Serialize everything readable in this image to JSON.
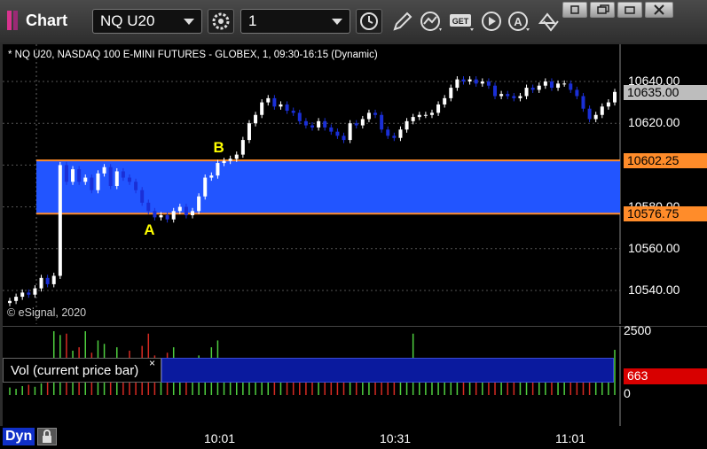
{
  "window": {
    "app_title": "Chart",
    "symbol": "NQ U20",
    "interval": "1"
  },
  "chart_header": "* NQ U20, NASDAQ 100 E-MINI FUTURES - GLOBEX, 1, 09:30-16:15 (Dynamic)",
  "copyright": "© eSignal, 2020",
  "colors": {
    "up": "#ffffff",
    "down": "#1a2fd6",
    "zone_fill": "#2255ff",
    "zone_line": "#ff8c2a",
    "last_price_tag": "#bdbdbd",
    "vol_up": "#4fcf3f",
    "vol_down": "#d62a22",
    "vol_tag": "#d80000",
    "annotation": "#ffff00"
  },
  "bottom": {
    "dyn_label": "Dyn",
    "time_labels": [
      "10:01",
      "10:31",
      "11:01"
    ]
  },
  "volume_pane": {
    "title": "Vol (current price bar)",
    "close_glyph": "×",
    "axis_labels": [
      "2500",
      "0"
    ],
    "current_value": "663"
  },
  "chart_data": {
    "type": "candlestick",
    "y_axis_ticks": [
      10640,
      10620,
      10600,
      10580,
      10560,
      10540
    ],
    "y_axis_labels": [
      "10640.00",
      "10620.00",
      "10600.00",
      "10580.00",
      "10560.00",
      "10540.00"
    ],
    "y_range": [
      10532,
      10650
    ],
    "x_time_ticks": [
      "10:01",
      "10:31",
      "11:01"
    ],
    "last_price": "10635.00",
    "zone": {
      "upper": 10602.25,
      "lower": 10576.75,
      "upper_label": "10602.25",
      "lower_label": "10576.75"
    },
    "annotations": [
      {
        "text": "A",
        "bar": 22,
        "price": 10573
      },
      {
        "text": "B",
        "bar": 33,
        "price": 10605
      }
    ],
    "closes": [
      10535,
      10537,
      10539,
      10538,
      10541,
      10546,
      10543,
      10547,
      10600,
      10592,
      10598,
      10592,
      10594,
      10588,
      10596,
      10599,
      10590,
      10597,
      10594,
      10592,
      10588,
      10582,
      10578,
      10575,
      10576,
      10574,
      10578,
      10580,
      10576,
      10578,
      10585,
      10594,
      10595,
      10601,
      10602,
      10603,
      10605,
      10612,
      10620,
      10624,
      10630,
      10632,
      10628,
      10629,
      10626,
      10625,
      10621,
      10619,
      10618,
      10621,
      10618,
      10616,
      10614,
      10612,
      10620,
      10619,
      10622,
      10625,
      10624,
      10617,
      10614,
      10613,
      10617,
      10621,
      10623,
      10624,
      10624,
      10625,
      10629,
      10632,
      10637,
      10641,
      10640,
      10641,
      10639,
      10640,
      10638,
      10633,
      10634,
      10633,
      10632,
      10633,
      10637,
      10636,
      10638,
      10640,
      10637,
      10639,
      10639,
      10636,
      10633,
      10627,
      10622,
      10624,
      10628,
      10630,
      10635
    ],
    "volume": [
      110,
      90,
      130,
      150,
      120,
      170,
      200,
      950,
      880,
      900,
      650,
      700,
      950,
      620,
      800,
      750,
      500,
      700,
      520,
      650,
      280,
      720,
      900,
      580,
      480,
      620,
      700,
      480,
      350,
      420,
      580,
      420,
      700,
      800,
      450,
      300,
      340,
      420,
      380,
      330,
      290,
      310,
      360,
      300,
      340,
      380,
      290,
      320,
      310,
      270,
      330,
      300,
      260,
      290,
      250,
      240,
      280,
      230,
      190,
      260,
      220,
      300,
      260,
      310,
      900,
      280,
      240,
      210,
      260,
      270,
      240,
      220,
      210,
      250,
      230,
      240,
      200,
      220,
      230,
      180,
      200,
      210,
      240,
      220,
      190,
      210,
      230,
      200,
      330,
      200,
      210,
      260,
      220,
      240,
      200,
      240,
      663
    ]
  }
}
